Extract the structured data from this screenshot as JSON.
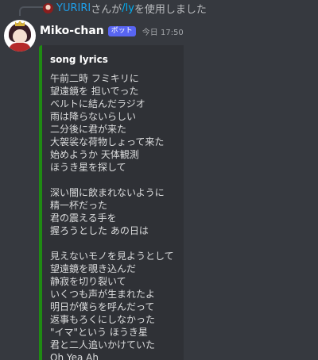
{
  "reply": {
    "user": "YURIRI",
    "text_before": "さんが",
    "command": "/ly",
    "text_after": "を使用しました"
  },
  "message": {
    "author": "Miko-chan",
    "bot_tag": "ボット",
    "timestamp": "今日 17:50"
  },
  "embed": {
    "accent_color": "#1f8b12",
    "title": "song lyrics",
    "lines": [
      "午前二時 フミキリに",
      "望遠鏡を 担いでった",
      "ベルトに結んだラジオ",
      "雨は降らないらしい",
      "二分後に君が来た",
      "大袈裟な荷物しょって来た",
      "始めようか 天体観測",
      "ほうき星を探して",
      "",
      "深い闇に飲まれないように",
      "精一杯だった",
      "君の震える手を",
      "握ろうとした あの日は",
      "",
      "見えないモノを見ようとして",
      "望遠鏡を覗き込んだ",
      "静寂を切り裂いて",
      "いくつも声が生まれたよ",
      "明日が僕らを呼んだって",
      "返事もろくにしなかった",
      "\"イマ\"という ほうき星",
      "君と二人追いかけていた",
      "Oh Yea Ah"
    ]
  }
}
